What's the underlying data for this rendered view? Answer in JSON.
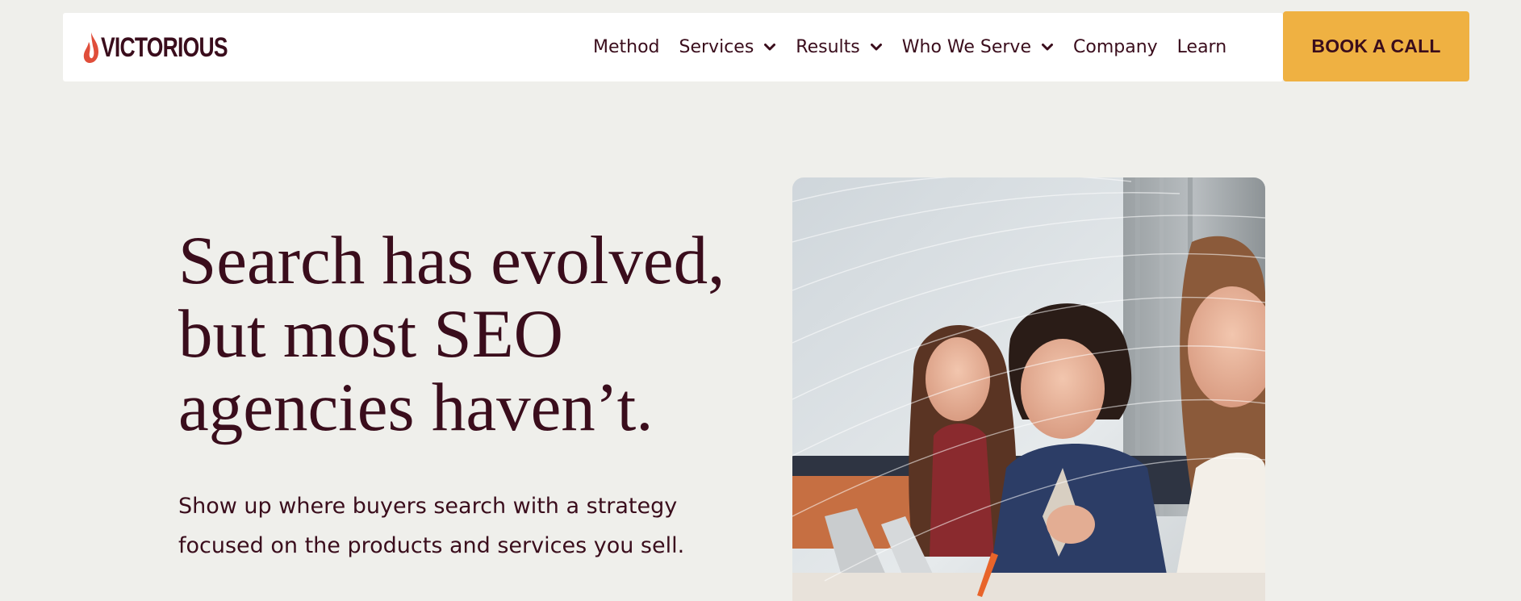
{
  "header": {
    "logo_text": "VICTORIOUS",
    "logo_icon": "flame-icon",
    "nav": [
      {
        "label": "Method",
        "dropdown": false
      },
      {
        "label": "Services",
        "dropdown": true
      },
      {
        "label": "Results",
        "dropdown": true
      },
      {
        "label": "Who We Serve",
        "dropdown": true
      },
      {
        "label": "Company",
        "dropdown": false
      },
      {
        "label": "Learn",
        "dropdown": false
      }
    ],
    "cta_label": "BOOK A CALL"
  },
  "hero": {
    "headline": "Search has evolved, but most SEO agencies haven’t.",
    "subtext": "Show up where buyers search with a strategy focused on the products and services you sell.",
    "image": "photo of three smiling women at a meeting table with laptops"
  },
  "colors": {
    "background": "#efefeb",
    "primary_text": "#3a0d1c",
    "accent": "#efb142",
    "logo_flame": "#e04e3a",
    "navbar_bg": "#ffffff"
  }
}
